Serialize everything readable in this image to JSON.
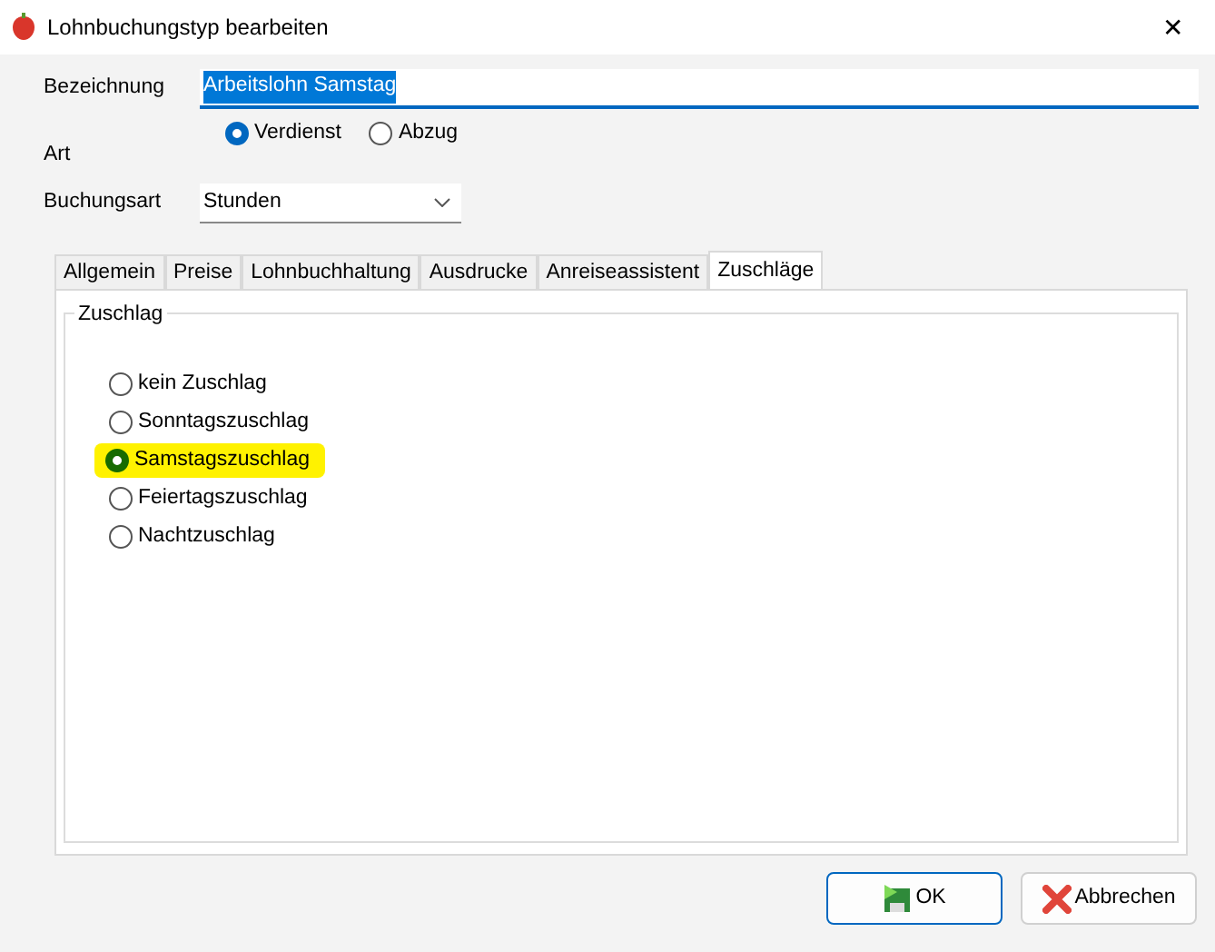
{
  "window": {
    "title": "Lohnbuchungstyp bearbeiten",
    "close": "✕"
  },
  "fields": {
    "bezeichnung_label": "Bezeichnung",
    "bezeichnung_value": "Arbeitslohn Samstag",
    "art_label": "Art",
    "art_options": [
      {
        "label": "Verdienst",
        "selected": true
      },
      {
        "label": "Abzug",
        "selected": false
      }
    ],
    "buchungsart_label": "Buchungsart",
    "buchungsart_value": "Stunden"
  },
  "tabs": [
    {
      "label": "Allgemein",
      "selected": false
    },
    {
      "label": "Preise",
      "selected": false
    },
    {
      "label": "Lohnbuchhaltung",
      "selected": false
    },
    {
      "label": "Ausdrucke",
      "selected": false
    },
    {
      "label": "Anreiseassistent",
      "selected": false
    },
    {
      "label": "Zuschläge",
      "selected": true
    }
  ],
  "group": {
    "title": "Zuschlag",
    "options": [
      {
        "label": "kein Zuschlag",
        "selected": false
      },
      {
        "label": "Sonntagszuschlag",
        "selected": false
      },
      {
        "label": "Samstagszuschlag",
        "selected": true
      },
      {
        "label": "Feiertagszuschlag",
        "selected": false
      },
      {
        "label": "Nachtzuschlag",
        "selected": false
      }
    ]
  },
  "buttons": [
    {
      "kind": "ok",
      "label": "OK"
    },
    {
      "kind": "cancel",
      "label": "Abbrechen"
    }
  ]
}
